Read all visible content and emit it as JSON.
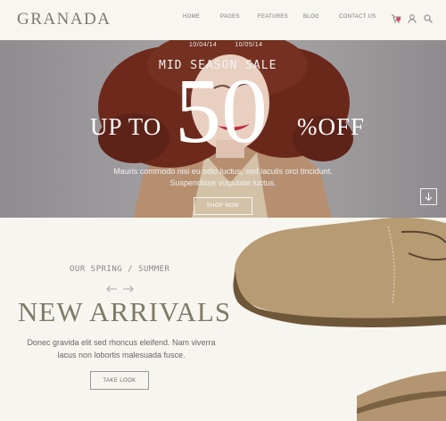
{
  "header": {
    "logo": "GRANADA",
    "nav": {
      "home": "HOME",
      "pages": "PAGES",
      "features": "FEATURES",
      "blog": "BLOG",
      "contact": "CONTACT US"
    },
    "icons": [
      "cart-icon",
      "user-icon",
      "search-icon"
    ]
  },
  "hero": {
    "date_start": "10/04/14",
    "date_end": "10/05/14",
    "subtitle": "MID SEASON SALE",
    "up_to": "UP TO",
    "percent_value": "50",
    "off": "%OFF",
    "description_line1": "Mauris commodo nisi eu odio luctus, sed iaculis orci tincidunt.",
    "description_line2": "Suspendisse vulputate luctus.",
    "button": "SHOP NOW"
  },
  "arrivals": {
    "pretitle": "OUR SPRING / SUMMER",
    "title": "NEW ARRIVALS",
    "description_line1": "Donec gravida elit sed rhoncus eleifend. Nam viverra",
    "description_line2": "lacus non lobortis malesuada fusce.",
    "button": "TAKE LOOK"
  },
  "colors": {
    "accent_badge": "#e14b6b",
    "title": "#7f7a68",
    "background": "#f7f5ef"
  }
}
